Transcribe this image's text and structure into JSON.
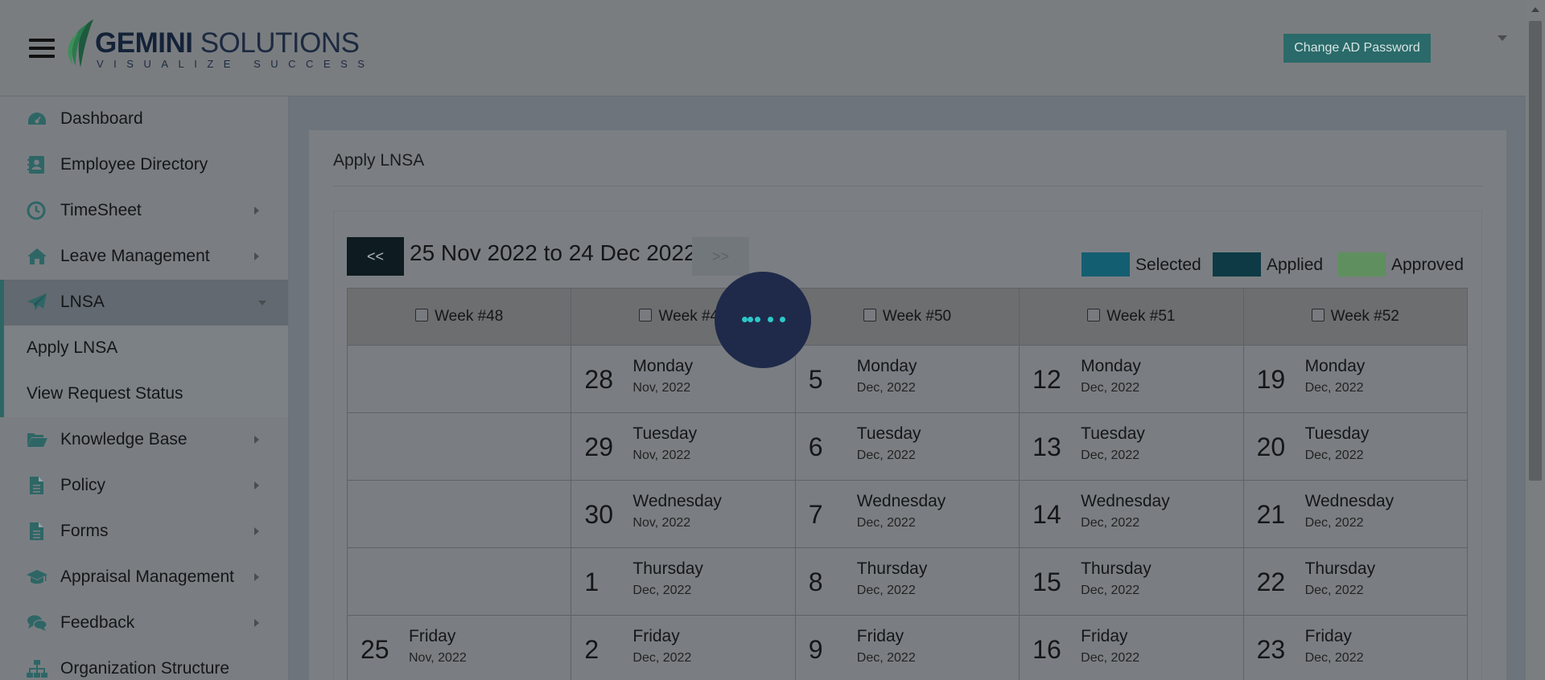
{
  "header": {
    "logo_brand": "GEMINI",
    "logo_name": "SOLUTIONS",
    "logo_tagline": "VISUALIZE SUCCESS",
    "change_password_label": "Change AD Password"
  },
  "sidebar": {
    "items": [
      {
        "label": "Dashboard",
        "icon": "dashboard-icon"
      },
      {
        "label": "Employee Directory",
        "icon": "address-book-icon"
      },
      {
        "label": "TimeSheet",
        "icon": "clock-icon"
      },
      {
        "label": "Leave Management",
        "icon": "home-icon"
      },
      {
        "label": "LNSA",
        "icon": "paper-plane-icon"
      },
      {
        "label": "Knowledge Base",
        "icon": "folder-open-icon"
      },
      {
        "label": "Policy",
        "icon": "file-icon"
      },
      {
        "label": "Forms",
        "icon": "file-icon"
      },
      {
        "label": "Appraisal Management",
        "icon": "graduation-cap-icon"
      },
      {
        "label": "Feedback",
        "icon": "comments-icon"
      },
      {
        "label": "Organization Structure",
        "icon": "sitemap-icon"
      }
    ],
    "sub_items": [
      {
        "label": "Apply LNSA"
      },
      {
        "label": "View Request Status"
      }
    ]
  },
  "main": {
    "title": "Apply LNSA",
    "prev_label": "<<",
    "next_label": ">>",
    "range": "25 Nov 2022 to 24 Dec 2022",
    "legend": [
      {
        "label": "Selected",
        "color": "#145e72"
      },
      {
        "label": "Applied",
        "color": "#0d3a45"
      },
      {
        "label": "Approved",
        "color": "#5f8f5f"
      }
    ],
    "weeks": [
      "Week #48",
      "Week #49",
      "Week #50",
      "Week #51",
      "Week #52"
    ],
    "rows": [
      [
        null,
        {
          "num": "28",
          "weekday": "Monday",
          "month": "Nov, 2022"
        },
        {
          "num": "5",
          "weekday": "Monday",
          "month": "Dec, 2022"
        },
        {
          "num": "12",
          "weekday": "Monday",
          "month": "Dec, 2022"
        },
        {
          "num": "19",
          "weekday": "Monday",
          "month": "Dec, 2022"
        }
      ],
      [
        null,
        {
          "num": "29",
          "weekday": "Tuesday",
          "month": "Nov, 2022"
        },
        {
          "num": "6",
          "weekday": "Tuesday",
          "month": "Dec, 2022"
        },
        {
          "num": "13",
          "weekday": "Tuesday",
          "month": "Dec, 2022"
        },
        {
          "num": "20",
          "weekday": "Tuesday",
          "month": "Dec, 2022"
        }
      ],
      [
        null,
        {
          "num": "30",
          "weekday": "Wednesday",
          "month": "Nov, 2022"
        },
        {
          "num": "7",
          "weekday": "Wednesday",
          "month": "Dec, 2022"
        },
        {
          "num": "14",
          "weekday": "Wednesday",
          "month": "Dec, 2022"
        },
        {
          "num": "21",
          "weekday": "Wednesday",
          "month": "Dec, 2022"
        }
      ],
      [
        null,
        {
          "num": "1",
          "weekday": "Thursday",
          "month": "Dec, 2022"
        },
        {
          "num": "8",
          "weekday": "Thursday",
          "month": "Dec, 2022"
        },
        {
          "num": "15",
          "weekday": "Thursday",
          "month": "Dec, 2022"
        },
        {
          "num": "22",
          "weekday": "Thursday",
          "month": "Dec, 2022"
        }
      ],
      [
        {
          "num": "25",
          "weekday": "Friday",
          "month": "Nov, 2022"
        },
        {
          "num": "2",
          "weekday": "Friday",
          "month": "Dec, 2022"
        },
        {
          "num": "9",
          "weekday": "Friday",
          "month": "Dec, 2022"
        },
        {
          "num": "16",
          "weekday": "Friday",
          "month": "Dec, 2022"
        },
        {
          "num": "23",
          "weekday": "Friday",
          "month": "Dec, 2022"
        }
      ]
    ]
  }
}
